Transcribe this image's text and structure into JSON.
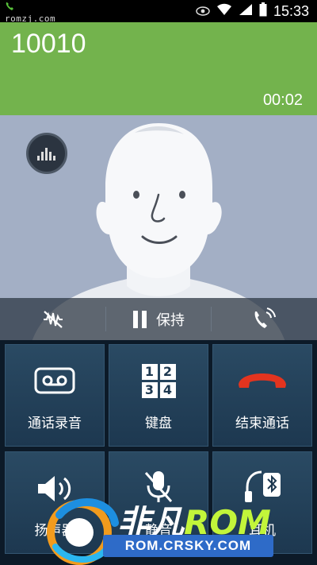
{
  "status_bar": {
    "site": "romzj.com",
    "time": "15:33",
    "icons": [
      "phone-icon",
      "eye-icon",
      "wifi-icon",
      "signal-icon",
      "battery-icon"
    ]
  },
  "call": {
    "number": "10010",
    "duration": "00:02"
  },
  "controls": {
    "hold_label": "保持",
    "icons": [
      "noise-reduction-icon",
      "pause-icon",
      "volume-boost-icon"
    ]
  },
  "actions": [
    {
      "label": "通话录音",
      "icon": "record-icon"
    },
    {
      "label": "键盘",
      "icon": "keypad-icon",
      "keys": [
        "1",
        "2",
        "3",
        "4"
      ]
    },
    {
      "label": "结束通话",
      "icon": "end-call-icon"
    },
    {
      "label": "扬声器",
      "icon": "speaker-icon"
    },
    {
      "label": "静音",
      "icon": "mute-icon"
    },
    {
      "label": "耳机",
      "icon": "bluetooth-headset-icon"
    }
  ],
  "watermark": {
    "line1_a": "非凡",
    "line1_b": "ROM",
    "line2": "ROM.CRSKY.COM"
  },
  "colors": {
    "header": "#73b34d",
    "contact_bg": "#a3afc5",
    "tile": "#234560",
    "end_call": "#e3341f"
  }
}
